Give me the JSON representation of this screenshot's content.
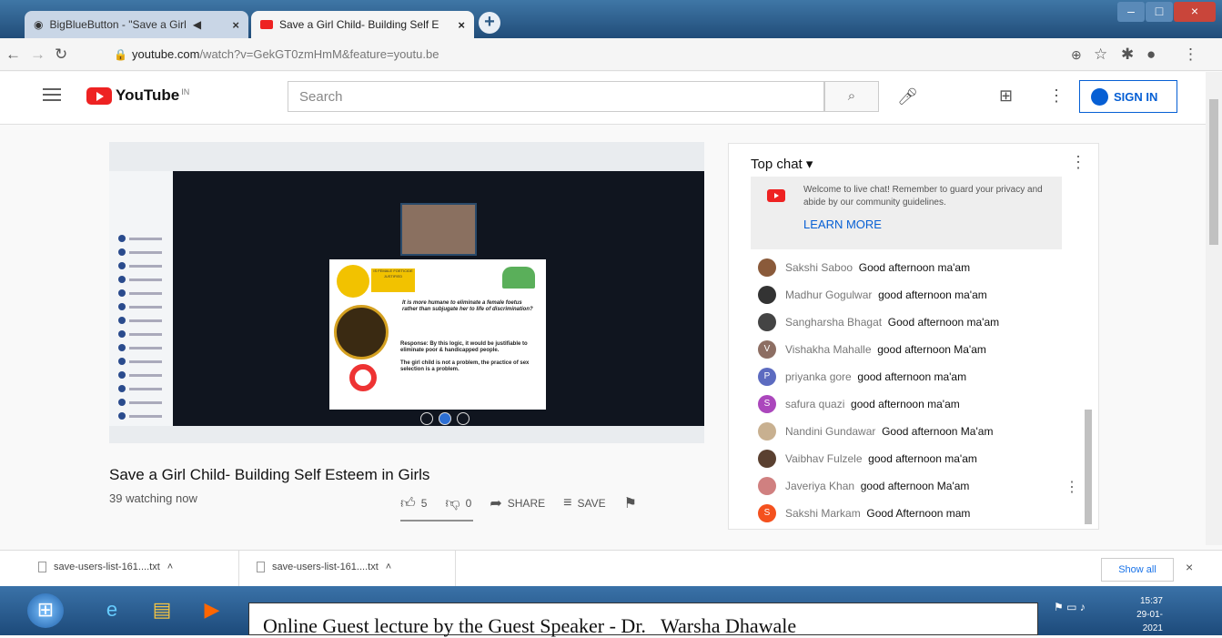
{
  "browser": {
    "tabs": [
      {
        "label": "BigBlueButton - \"Save a Girl"
      },
      {
        "label": "Save a Girl Child- Building Self E"
      }
    ],
    "new_tab_label": "+",
    "url_host": "youtube.com",
    "url_path": "/watch?v=GekGT0zmHmM&feature=youtu.be"
  },
  "youtube": {
    "logo_text": "YouTube",
    "region": "IN",
    "search_placeholder": "Search",
    "signin_label": "SIGN IN"
  },
  "video": {
    "title": "Save a Girl Child- Building Self Esteem in Girls",
    "watching": "39 watching now",
    "likes": "5",
    "dislikes": "0",
    "share_label": "SHARE",
    "save_label": "SAVE",
    "slide": {
      "header": "IS FEMALE FOETICIDE JUSTIFIED",
      "question": "It is more humane to eliminate a female foetus rather than subjugate her to life of discrimination?",
      "response": "Response: By this logic, it would be justifiable to eliminate poor & handicapped people.",
      "conclusion": "The girl child is not a problem, the practice of sex selection is a problem."
    }
  },
  "chat": {
    "header": "Top chat",
    "welcome_text": "Welcome to live chat! Remember to guard your privacy and abide by our community guidelines.",
    "learn_more": "LEARN MORE",
    "messages": [
      {
        "name": "Sakshi Saboo",
        "text": "Good afternoon ma'am",
        "initial": "",
        "color": "#8a5a3a"
      },
      {
        "name": "Madhur Gogulwar",
        "text": "good afternoon ma'am",
        "initial": "",
        "color": "#333333"
      },
      {
        "name": "Sangharsha Bhagat",
        "text": "Good afternoon ma'am",
        "initial": "",
        "color": "#444444"
      },
      {
        "name": "Vishakha Mahalle",
        "text": "good afternoon Ma'am",
        "initial": "V",
        "color": "#8d6e63"
      },
      {
        "name": "priyanka gore",
        "text": "good afternoon ma'am",
        "initial": "P",
        "color": "#5c6bc0"
      },
      {
        "name": "safura quazi",
        "text": "good afternoon ma'am",
        "initial": "S",
        "color": "#ab47bc"
      },
      {
        "name": "Nandini Gundawar",
        "text": "Good afternoon Ma'am",
        "initial": "",
        "color": "#c8b090"
      },
      {
        "name": "Vaibhav Fulzele",
        "text": "good afternoon ma'am",
        "initial": "",
        "color": "#5a4030"
      },
      {
        "name": "Javeriya Khan",
        "text": "good afternoon Ma'am",
        "initial": "",
        "color": "#d08080"
      },
      {
        "name": "Sakshi Markam",
        "text": "Good Afternoon mam",
        "initial": "S",
        "color": "#f4511e"
      }
    ]
  },
  "downloads": {
    "items": [
      {
        "label": "save-users-list-161....txt"
      },
      {
        "label": "save-users-list-161....txt"
      }
    ],
    "show_all": "Show all",
    "close": "×"
  },
  "taskbar": {
    "time": "15:37",
    "date": "29-01-2021"
  },
  "caption": "Online Guest lecture by the Guest Speaker - Dr.   Warsha Dhawale"
}
